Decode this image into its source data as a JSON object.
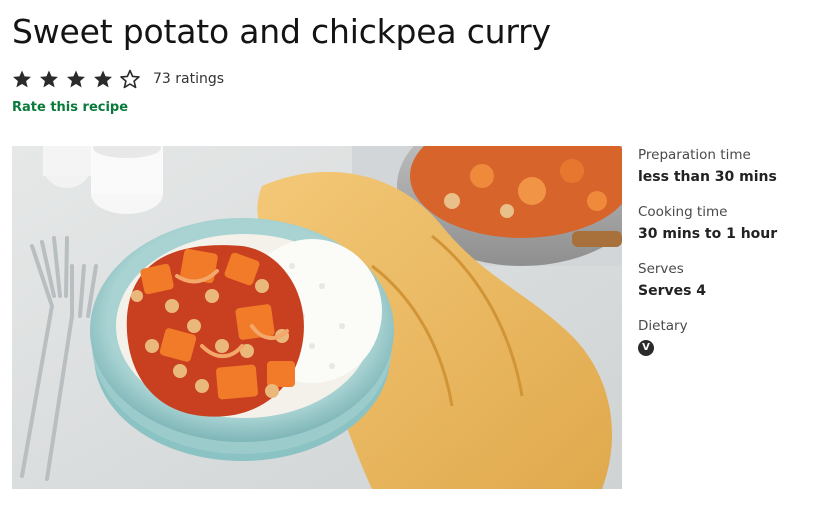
{
  "recipe": {
    "title": "Sweet potato and chickpea curry",
    "rating": {
      "stars_filled": 4,
      "stars_total": 5,
      "count_label": "73 ratings"
    },
    "rate_link_label": "Rate this recipe",
    "image": {
      "subject": "sweet-potato-chickpea-curry-photo"
    }
  },
  "details": [
    {
      "label": "Preparation time",
      "value": "less than 30 mins"
    },
    {
      "label": "Cooking time",
      "value": "30 mins to 1 hour"
    },
    {
      "label": "Serves",
      "value": "Serves 4"
    },
    {
      "label": "Dietary",
      "badge": "V",
      "badge_meaning": "vegetarian"
    }
  ],
  "colors": {
    "text": "#141414",
    "link": "#0a7a3b",
    "star": "#2b2b2b",
    "badge_bg": "#2b2b2b"
  },
  "icons": [
    "star-filled-icon",
    "star-outline-icon",
    "vegetarian-icon"
  ]
}
